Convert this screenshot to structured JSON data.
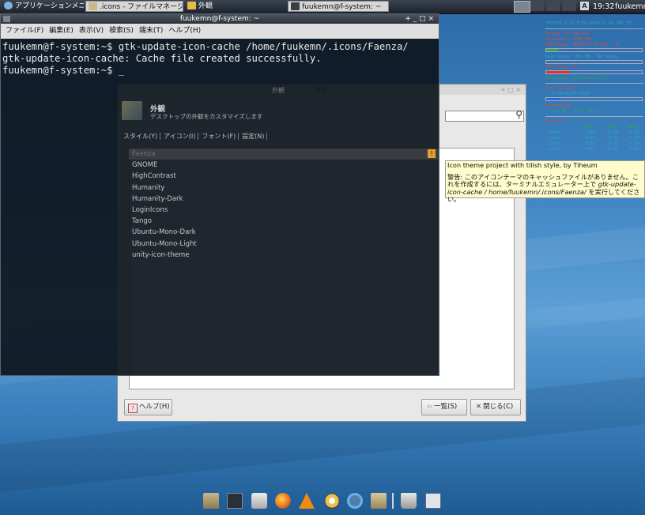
{
  "panel": {
    "app_menu": "アプリケーションメニュー",
    "tasks": [
      ".icons - ファイルマネージャー",
      "外観",
      "fuukemn@f-system: ~"
    ],
    "clock": "19:32",
    "user": "fuukemn",
    "input_method": "A"
  },
  "terminal": {
    "title": "fuukemn@f-system: ~",
    "title_controls": "+ _ □ ×",
    "menu": [
      "ファイル(F)",
      "編集(E)",
      "表示(V)",
      "検索(S)",
      "端末(T)",
      "ヘルプ(H)"
    ],
    "lines": [
      "fuukemn@f-system:~$ gtk-update-icon-cache /home/fuukemn/.icons/Faenza/",
      "gtk-update-icon-cache: Cache file created successfully.",
      "fuukemn@f-system:~$ _"
    ]
  },
  "appearance": {
    "window_title": "外観",
    "title_controls": "+ □ ×",
    "heading": "外観",
    "subtitle": "デスクトップの外観をカスタマイズします",
    "tabs": [
      "スタイル(Y)",
      "アイコン(I)",
      "フォント(F)",
      "設定(N)"
    ],
    "selected_item": "Faenza",
    "icon_themes": [
      "GNOME",
      "HighContrast",
      "Humanity",
      "Humanity-Dark",
      "LoginIcons",
      "Tango",
      "Ubuntu-Mono-Dark",
      "Ubuntu-Mono-Light",
      "unity-icon-theme"
    ],
    "help_button": "ヘルプ(H)",
    "list_button": "一覧(S)",
    "close_button": "閉じる(C)"
  },
  "tooltip": {
    "line1": "Icon theme project with tilish style, by Tiheum",
    "warning_start": "警告: このアイコンテーマのキャッシュファイルがありません。これを作成するには、ターミナルエミュレーター上で",
    "warning_cmd": "gtk-update-icon-cache / home/fuukemn/.icons/Faenza/",
    "warning_end": "を実行してください。"
  },
  "conky": {
    "kernel": "Kernel 3.13.0-62-generic on x86_64",
    "uptime": "Uptime:  0h 14m 41s",
    "frequency": "Frequency: 2000 MHz",
    "ram": "RAM Usage: 983MiB/7.67GiB - 12",
    "swap": "Swap Usage: 0B  /0B  - No swap$",
    "cpu": "CPU Usage: 25",
    "processes": "Processes: 200  Running: 0",
    "fs_label": "File systems:",
    "fs": "5.60GiB/34.3GiB",
    "net_label": "Networking:",
    "net": "Up: 0B   - Down: 0B",
    "top_label": "Process:",
    "top_header": [
      "NAME",
      "PID",
      "CPU%",
      "MEM%"
    ],
    "top_rows": [
      [
        "conky",
        "3248",
        "0.25",
        "0.10"
      ],
      [
        "conky",
        "3243",
        "0.23",
        "0.10"
      ],
      [
        "conky",
        "3236",
        "0.23",
        "0.10"
      ],
      [
        "conky",
        "3207",
        "0.23",
        "0.10"
      ]
    ]
  },
  "dock": [
    "home-folder-icon",
    "terminal-icon",
    "file-cabinet-icon",
    "firefox-icon",
    "vlc-icon",
    "app-icon",
    "search-icon",
    "folder-icon",
    "trash-icon",
    "keyboard-icon"
  ],
  "colors": {
    "terminal_bg": "#0e161e",
    "tooltip_bg": "#fffccc",
    "conky_text": "#2aa6c9",
    "conky_alert": "#e04a3a"
  }
}
